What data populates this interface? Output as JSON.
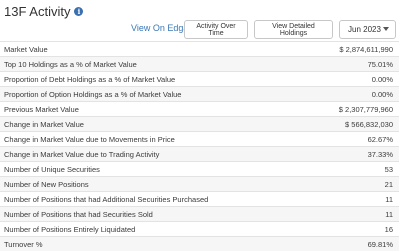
{
  "header": {
    "title": "13F Activity",
    "info_glyph": "i"
  },
  "toolbar": {
    "view_edgar": "View On Edgar",
    "activity_over_time": "Activity Over Time",
    "view_detailed_holdings": "View Detailed Holdings",
    "period_select": "Jun 2023"
  },
  "icons": {
    "info": "info-icon",
    "dropdown": "chevron-down-icon"
  },
  "colors": {
    "link": "#3a78b5",
    "info_icon": "#3a6fb0"
  },
  "rows": [
    {
      "label": "Market Value",
      "value": "$ 2,874,611,990"
    },
    {
      "label": "Top 10 Holdings as a % of Market Value",
      "value": "75.01%"
    },
    {
      "label": "Proportion of Debt Holdings as a % of Market Value",
      "value": "0.00%"
    },
    {
      "label": "Proportion of Option Holdings as a % of Market Value",
      "value": "0.00%"
    },
    {
      "label": "Previous Market Value",
      "value": "$ 2,307,779,960"
    },
    {
      "label": "Change in Market Value",
      "value": "$ 566,832,030"
    },
    {
      "label": "Change in Market Value due to Movements in Price",
      "value": "62.67%"
    },
    {
      "label": "Change in Market Value due to Trading Activity",
      "value": "37.33%"
    },
    {
      "label": "Number of Unique Securities",
      "value": "53"
    },
    {
      "label": "Number of New Positions",
      "value": "21"
    },
    {
      "label": "Number of Positions that had Additional Securities Purchased",
      "value": "11"
    },
    {
      "label": "Number of Positions that had Securities Sold",
      "value": "11"
    },
    {
      "label": "Number of Positions Entirely Liquidated",
      "value": "16"
    },
    {
      "label": "Turnover %",
      "value": "69.81%"
    }
  ]
}
